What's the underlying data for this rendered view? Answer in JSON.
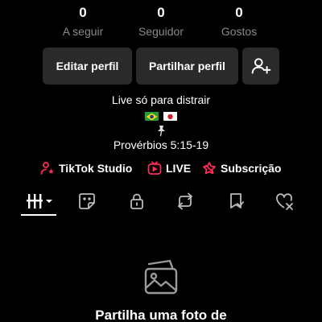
{
  "stats": [
    {
      "value": "0",
      "label": "A seguir"
    },
    {
      "value": "0",
      "label": "Seguidor"
    },
    {
      "value": "0",
      "label": "Gostos"
    }
  ],
  "buttons": {
    "edit_profile": "Editar perfil",
    "share_profile": "Partilhar perfil",
    "add_friend_icon": "person-add-icon"
  },
  "bio": {
    "line1": "Live só para distrair",
    "flags": [
      "brazil-flag",
      "japan-flag"
    ],
    "line3": "Provérbios 5:15-19"
  },
  "links": [
    {
      "label": "TikTok Studio",
      "icon": "studio-icon"
    },
    {
      "label": "LIVE",
      "icon": "live-tv-icon"
    },
    {
      "label": "Subscrição",
      "icon": "subscription-icon"
    }
  ],
  "tabs": [
    "grid-icon",
    "sticker-icon",
    "lock-icon",
    "repost-icon",
    "favorites-icon",
    "liked-icon"
  ],
  "empty_state": {
    "icon": "photos-icon",
    "title": "Partilha uma foto de"
  },
  "colors": {
    "background": "#000000",
    "button_bg": "#2a2a2a",
    "muted_text": "#8a8a8a",
    "accent_red": "#fe2c55"
  }
}
